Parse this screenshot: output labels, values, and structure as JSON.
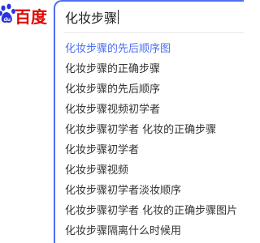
{
  "brand": {
    "logo_text": "百度",
    "logo_color": "#e10601"
  },
  "search": {
    "value": "化妆步骤",
    "accent_color": "#4e6ef2"
  },
  "suggestions": [
    {
      "text": "化妆步骤的先后顺序图"
    },
    {
      "text": "化妆步骤的正确步骤"
    },
    {
      "text": "化妆步骤的先后顺序"
    },
    {
      "text": "化妆步骤视频初学者"
    },
    {
      "text": "化妆步骤初学者 化妆的正确步骤"
    },
    {
      "text": "化妆步骤初学者"
    },
    {
      "text": "化妆步骤视频"
    },
    {
      "text": "化妆步骤初学者淡妆顺序"
    },
    {
      "text": "化妆步骤初学者 化妆的正确步骤图片"
    },
    {
      "text": "化妆步骤隔离什么时候用"
    }
  ],
  "icons": {
    "logo_icon": "baidu-paw-icon"
  }
}
